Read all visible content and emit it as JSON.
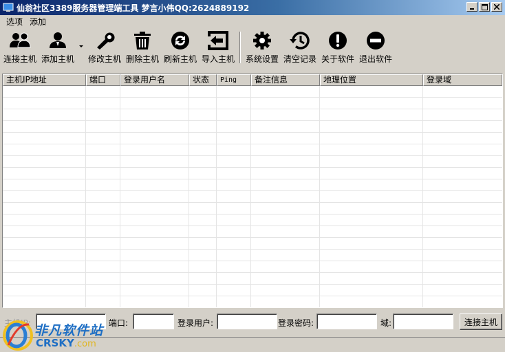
{
  "window": {
    "title": "仙翁社区3389服务器管理端工具   梦言小伟QQ:2624889192"
  },
  "menu": {
    "items": [
      "选项",
      "添加"
    ]
  },
  "toolbar": {
    "buttons": [
      {
        "label": "连接主机",
        "icon": "users-icon"
      },
      {
        "label": "添加主机",
        "icon": "add-user-icon"
      },
      {
        "label": "修改主机",
        "icon": "wrench-icon"
      },
      {
        "label": "删除主机",
        "icon": "trash-icon"
      },
      {
        "label": "刷新主机",
        "icon": "refresh-icon"
      },
      {
        "label": "导入主机",
        "icon": "import-icon"
      },
      {
        "label": "系统设置",
        "icon": "gear-icon"
      },
      {
        "label": "清空记录",
        "icon": "history-icon"
      },
      {
        "label": "关于软件",
        "icon": "info-icon"
      },
      {
        "label": "退出软件",
        "icon": "minus-circle-icon"
      }
    ]
  },
  "table": {
    "columns": [
      "主机IP地址",
      "端口",
      "登录用户名",
      "状态",
      "Ping",
      "备注信息",
      "地理位置",
      "登录域"
    ],
    "rows": []
  },
  "form": {
    "ip_label": "主机IP:",
    "port_label": "端口:",
    "user_label": "登录用户:",
    "password_label": "登录密码:",
    "domain_label": "域:",
    "ip_value": "",
    "port_value": "",
    "user_value": "",
    "password_value": "",
    "domain_value": "",
    "connect_label": "连接主机"
  },
  "watermark": {
    "cn": "非凡软件站",
    "en": "CRSKY",
    "suffix": ".com"
  },
  "colors": {
    "title_start": "#0a246a",
    "title_end": "#a6caf0",
    "face": "#d4d0c8",
    "watermark": "#1f6fc4"
  }
}
